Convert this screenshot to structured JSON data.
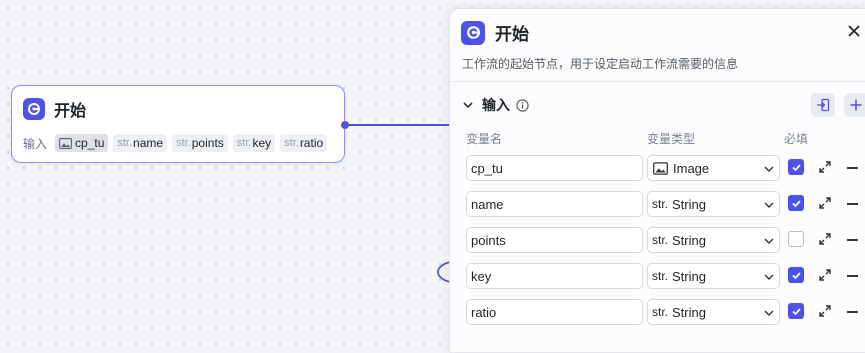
{
  "canvas": {
    "node": {
      "title": "开始",
      "inputs_label": "输入",
      "tags": [
        {
          "prefix": "",
          "name": "cp_tu",
          "icon": "image-icon"
        },
        {
          "prefix": "str.",
          "name": "name"
        },
        {
          "prefix": "str.",
          "name": "points"
        },
        {
          "prefix": "str.",
          "name": "key"
        },
        {
          "prefix": "str.",
          "name": "ratio"
        }
      ]
    }
  },
  "panel": {
    "title": "开始",
    "description": "工作流的起始节点，用于设定启动工作流需要的信息",
    "section_title": "输入",
    "columns": {
      "name": "变量名",
      "type": "变量类型",
      "required": "必填"
    },
    "rows": [
      {
        "name": "cp_tu",
        "type_prefix": "",
        "type": "Image",
        "type_icon": "image-icon",
        "required": true
      },
      {
        "name": "name",
        "type_prefix": "str.",
        "type": "String",
        "required": true
      },
      {
        "name": "points",
        "type_prefix": "str.",
        "type": "String",
        "required": false
      },
      {
        "name": "key",
        "type_prefix": "str.",
        "type": "String",
        "required": true
      },
      {
        "name": "ratio",
        "type_prefix": "str.",
        "type": "String",
        "required": true
      }
    ]
  },
  "colors": {
    "accent": "#4d53e8"
  }
}
